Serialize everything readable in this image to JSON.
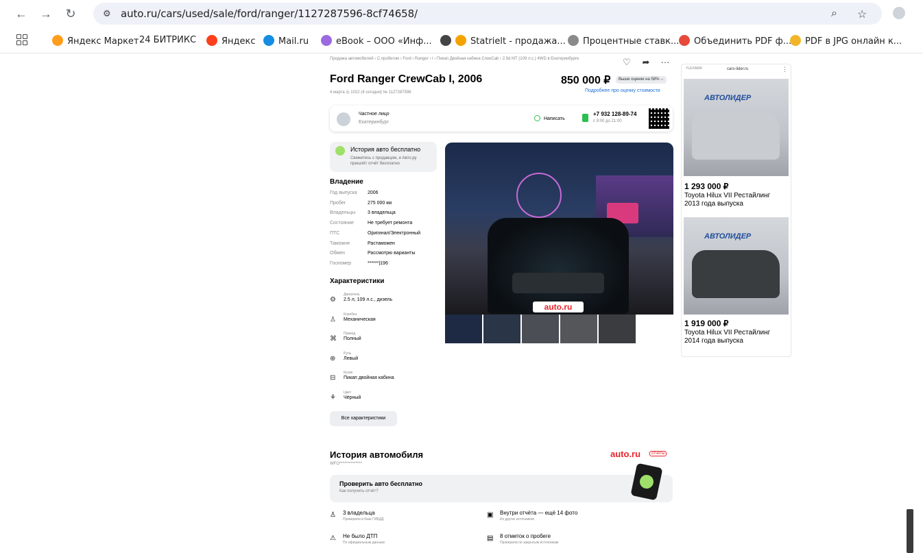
{
  "browser": {
    "url": "auto.ru/cars/used/sale/ford/ranger/1127287596-8cf74658/",
    "bookmarks": [
      {
        "label": "Яндекс Маркет",
        "color": "#ff9d1d"
      },
      {
        "label": "24 БИТРИКС",
        "color": "#2fc6f6"
      },
      {
        "label": "Яндекс",
        "color": "#fc3f1d"
      },
      {
        "label": "Mail.ru",
        "color": "#168de2"
      },
      {
        "label": "eBook – ООО «Инф...",
        "color": "#9c6ae0"
      },
      {
        "label": "",
        "color": "#444444"
      },
      {
        "label": "Statrielt - продажа...",
        "color": "#f3a300"
      },
      {
        "label": "Процентные ставк...",
        "color": "#8a8a8a"
      },
      {
        "label": "Объединить PDF ф...",
        "color": "#e64a3a"
      },
      {
        "label": "PDF в JPG онлайн к...",
        "color": "#f2b52a"
      }
    ]
  },
  "listing": {
    "breadcrumbs": "Продажа автомобилей  ›  С пробегом  ›  Ford  ›  Ranger  ›  I  ›  Пикап Двойная кабина CrewCab  ›  2.5d MT (109 л.с.) 4WD в Екатеринбурге",
    "title": "Ford Ranger CrewCab I, 2006",
    "price": "850 000 ₽",
    "price_badge": "Выше оценки на 58% ⌵",
    "meta": "4 марта  ◎ 1022 (4 сегодня)  № 1127287596",
    "estimate_link": "Подробнее про оценку стоимости",
    "seller_name": "Частное лицо",
    "seller_city": "Екатеринбург",
    "write_label": "Написать",
    "phone": "+7 932 128-89-74",
    "phone_hours": "с 9:00 до 21:00",
    "history_free_title": "История авто бесплатно",
    "history_free_sub": "Свяжитесь с продавцом, и Авто.ру пришлёт отчёт бесплатно",
    "ownership_title": "Владение",
    "ownership": [
      {
        "k": "Год выпуска",
        "v": "2006"
      },
      {
        "k": "Пробег",
        "v": "275 000 км"
      },
      {
        "k": "Владельцы",
        "v": "3 владельца"
      },
      {
        "k": "Состояние",
        "v": "Не требует ремонта"
      },
      {
        "k": "ПТС",
        "v": "Оригинал/Электронный"
      },
      {
        "k": "Таможня",
        "v": "Растаможен"
      },
      {
        "k": "Обмен",
        "v": "Рассмотрю варианты"
      },
      {
        "k": "Госномер",
        "v": "******|196"
      }
    ],
    "chars_title": "Характеристики",
    "chars": [
      {
        "cap": "Двигатель",
        "val": "2.5 л, 109 л.с., дизель",
        "icon": "engine-icon"
      },
      {
        "cap": "Коробка",
        "val": "Механическая",
        "icon": "gearbox-icon"
      },
      {
        "cap": "Привод",
        "val": "Полный",
        "icon": "drive-icon"
      },
      {
        "cap": "Руль",
        "val": "Левый",
        "icon": "steering-wheel-icon"
      },
      {
        "cap": "Кузов",
        "val": "Пикап двойная кабина",
        "icon": "body-icon"
      },
      {
        "cap": "Цвет",
        "val": "Чёрный",
        "icon": "color-icon"
      }
    ],
    "all_chars_button": "Все характеристики",
    "plate_text": "auto.ru"
  },
  "ad": {
    "label": "YLEXAMA",
    "domain": "cars-lider.ru",
    "logo": "АВТОЛИДЕР",
    "items": [
      {
        "price": "1 293 000 ₽",
        "name": "Toyota Hilux VII Рестайлинг 2013 года выпуска",
        "car_color": "#c9ccd0"
      },
      {
        "price": "1 919 000 ₽",
        "name": "Toyota Hilux VII Рестайлинг 2014 года выпуска",
        "car_color": "#3a3d40"
      }
    ]
  },
  "history": {
    "title": "История автомобиля",
    "vin": "WFO**************",
    "logo": "auto.ru",
    "logo_tag": "отчёты",
    "check_title": "Проверить авто бесплатно",
    "check_sub": "Как получить отчёт?",
    "items": [
      {
        "t": "3 владельца",
        "s": "Проверили в базе ГИБДД"
      },
      {
        "t": "Внутри отчёта — ещё 14 фото",
        "s": "Из других источников"
      },
      {
        "t": "Не было ДТП",
        "s": "По официальным данным"
      },
      {
        "t": "8 отметок о пробеге",
        "s": "Проверили по закрытым источникам"
      }
    ]
  }
}
